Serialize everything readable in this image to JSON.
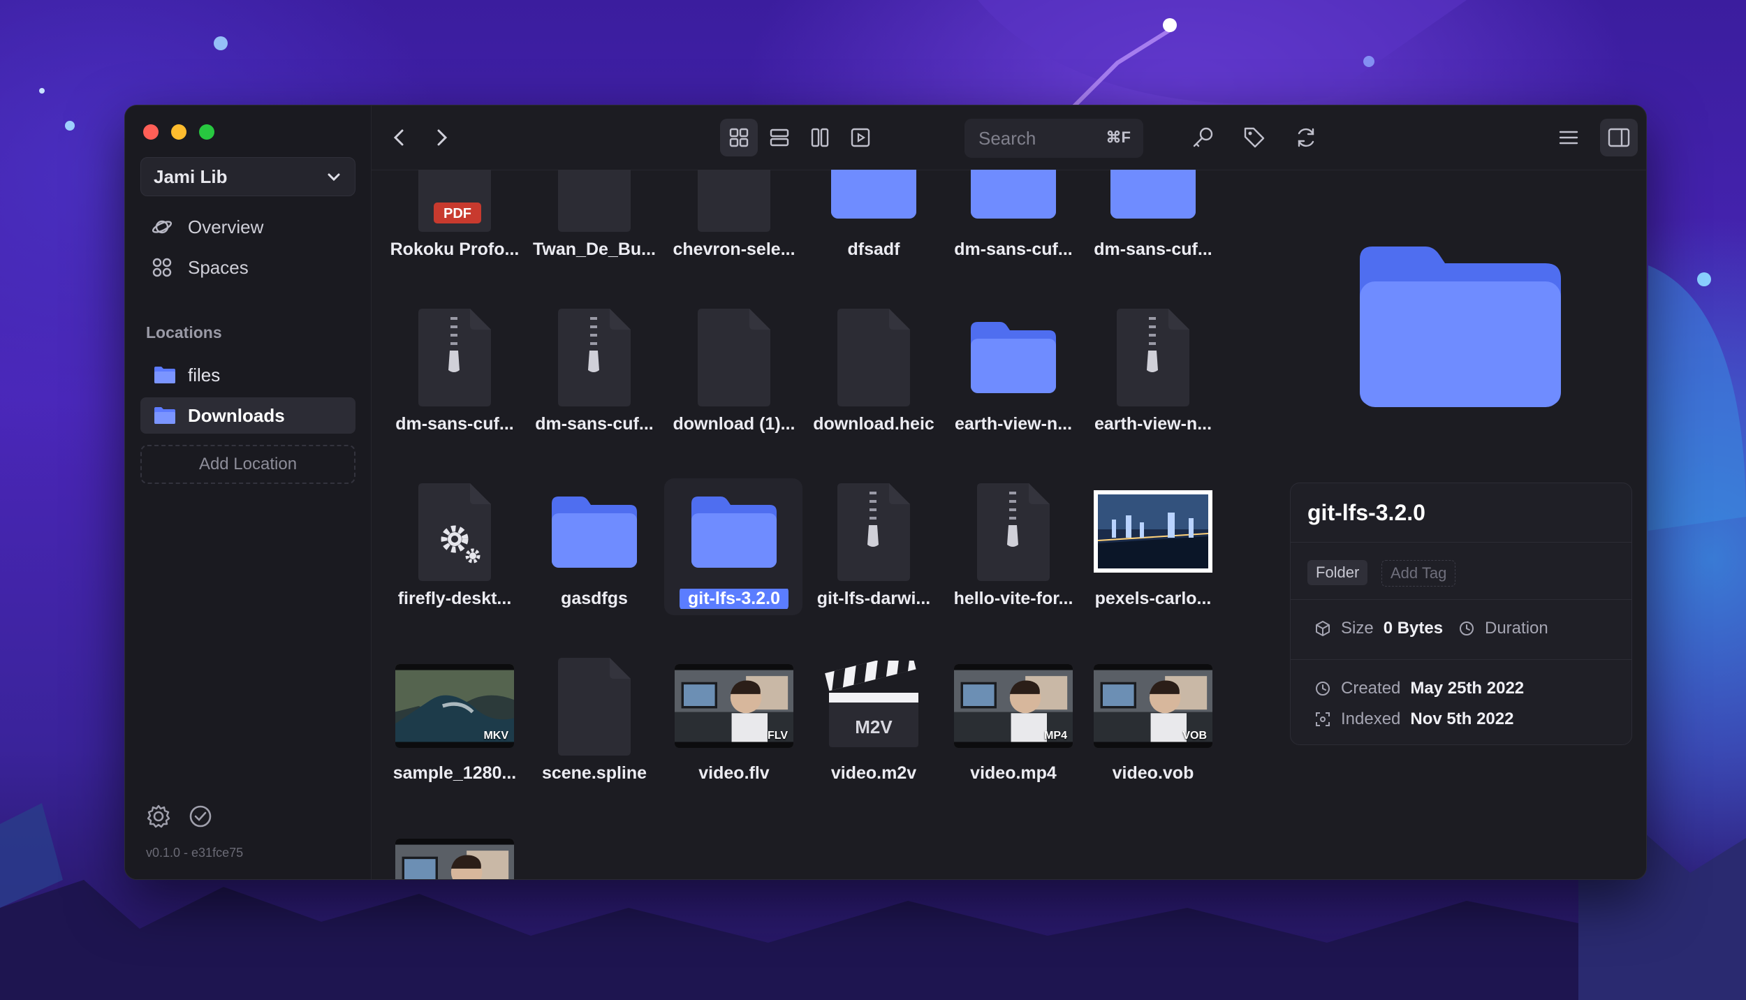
{
  "sidebar": {
    "library": "Jami Lib",
    "nav": [
      {
        "label": "Overview",
        "icon": "planet-icon"
      },
      {
        "label": "Spaces",
        "icon": "grid-circles-icon"
      }
    ],
    "locations_title": "Locations",
    "locations": [
      {
        "label": "files",
        "active": false
      },
      {
        "label": "Downloads",
        "active": true
      }
    ],
    "add_location": "Add Location",
    "version": "v0.1.0 - e31fce75"
  },
  "toolbar": {
    "search_placeholder": "Search",
    "search_shortcut": "⌘F"
  },
  "files": [
    {
      "name": "Rokoku Profo...",
      "kind": "pdf",
      "badge": "PDF"
    },
    {
      "name": "Twan_De_Bu...",
      "kind": "doc"
    },
    {
      "name": "chevron-sele...",
      "kind": "doc"
    },
    {
      "name": "dfsadf",
      "kind": "folder"
    },
    {
      "name": "dm-sans-cuf...",
      "kind": "folder"
    },
    {
      "name": "dm-sans-cuf...",
      "kind": "folder"
    },
    {
      "name": "dm-sans-cuf...",
      "kind": "zip"
    },
    {
      "name": "dm-sans-cuf...",
      "kind": "zip"
    },
    {
      "name": "download (1)...",
      "kind": "doc"
    },
    {
      "name": "download.heic",
      "kind": "doc"
    },
    {
      "name": "earth-view-n...",
      "kind": "folder"
    },
    {
      "name": "earth-view-n...",
      "kind": "zip"
    },
    {
      "name": "firefly-deskt...",
      "kind": "exe"
    },
    {
      "name": "gasdfgs",
      "kind": "folder"
    },
    {
      "name": "git-lfs-3.2.0",
      "kind": "folder",
      "selected": true
    },
    {
      "name": "git-lfs-darwi...",
      "kind": "zip"
    },
    {
      "name": "hello-vite-for...",
      "kind": "zip"
    },
    {
      "name": "pexels-carlo...",
      "kind": "image"
    },
    {
      "name": "sample_1280...",
      "kind": "video",
      "badge": "MKV"
    },
    {
      "name": "scene.spline",
      "kind": "doc"
    },
    {
      "name": "video.flv",
      "kind": "video",
      "badge": "FLV"
    },
    {
      "name": "video.m2v",
      "kind": "clapper",
      "badge": "M2V"
    },
    {
      "name": "video.mp4",
      "kind": "video",
      "badge": "MP4"
    },
    {
      "name": "video.vob",
      "kind": "video",
      "badge": "VOB"
    },
    {
      "name": "",
      "kind": "video"
    }
  ],
  "inspector": {
    "name": "git-lfs-3.2.0",
    "tag": "Folder",
    "add_tag": "Add Tag",
    "size_label": "Size",
    "size_value": "0 Bytes",
    "duration_label": "Duration",
    "created_label": "Created",
    "created_value": "May 25th 2022",
    "indexed_label": "Indexed",
    "indexed_value": "Nov 5th 2022"
  },
  "colors": {
    "accent": "#5b7dff",
    "folder": "#6f8cff",
    "window_bg": "#1c1c22"
  }
}
